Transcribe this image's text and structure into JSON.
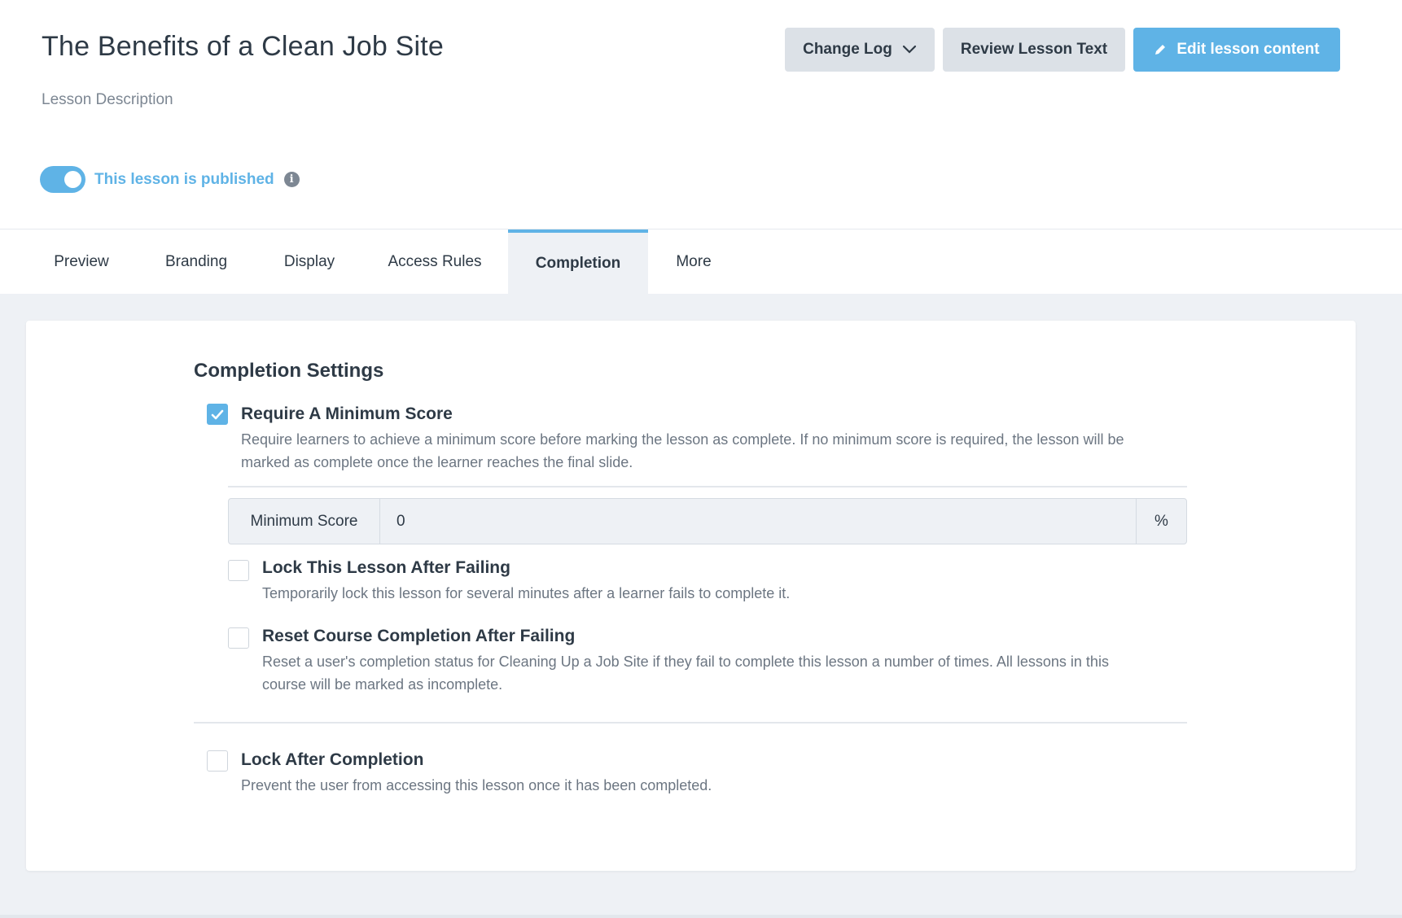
{
  "header": {
    "title": "The Benefits of a Clean Job Site",
    "description": "Lesson Description",
    "buttons": {
      "change_log": "Change Log",
      "review_text": "Review Lesson Text",
      "edit_content": "Edit lesson content"
    },
    "published_label": "This lesson is published",
    "published": true
  },
  "tabs": [
    {
      "label": "Preview",
      "active": false
    },
    {
      "label": "Branding",
      "active": false
    },
    {
      "label": "Display",
      "active": false
    },
    {
      "label": "Access Rules",
      "active": false
    },
    {
      "label": "Completion",
      "active": true
    },
    {
      "label": "More",
      "active": false
    }
  ],
  "completion": {
    "section_title": "Completion Settings",
    "require_min_score": {
      "checked": true,
      "title": "Require A Minimum Score",
      "desc_line1": "Require learners to achieve a minimum score before marking the lesson as complete. If no minimum score is required, the lesson will be",
      "desc_line2": "marked as complete once the learner reaches the final slide."
    },
    "min_score": {
      "label": "Minimum Score",
      "value": "0",
      "suffix": "%"
    },
    "lock_after_failing": {
      "checked": false,
      "title": "Lock This Lesson After Failing",
      "desc": "Temporarily lock this lesson for several minutes after a learner fails to complete it."
    },
    "reset_after_failing": {
      "checked": false,
      "title": "Reset Course Completion After Failing",
      "desc_line1": "Reset a user's completion status for Cleaning Up a Job Site if they fail to complete this lesson a number of times. All lessons in this",
      "desc_line2": "course will be marked as incomplete."
    },
    "lock_after_completion": {
      "checked": false,
      "title": "Lock After Completion",
      "desc": "Prevent the user from accessing this lesson once it has been completed."
    }
  },
  "colors": {
    "accent": "#5fb3e6",
    "button_grey": "#dce1e7",
    "page_bg": "#eef1f5",
    "text": "#2e3a46"
  }
}
